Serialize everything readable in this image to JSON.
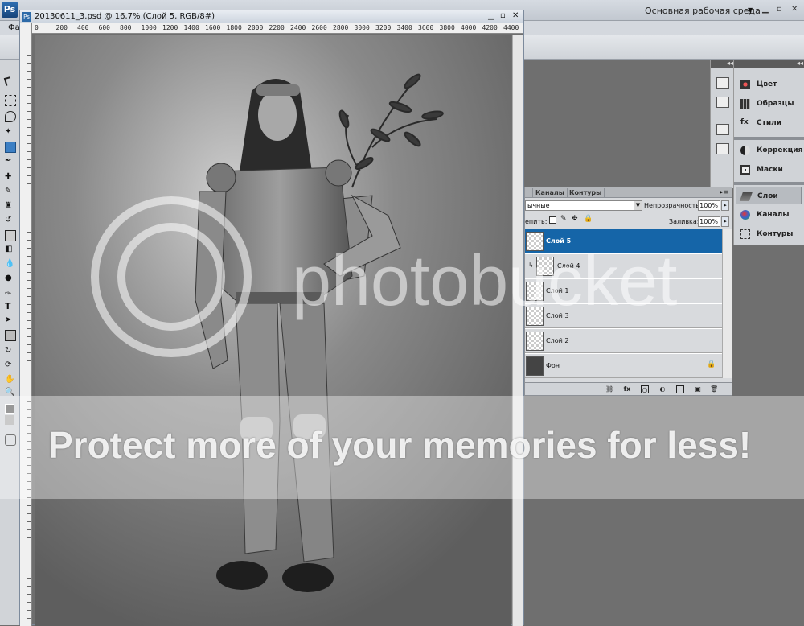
{
  "app": {
    "logo": "Ps",
    "menu_fragment": "Фа",
    "workspace": "Основная рабочая среда",
    "window_controls": [
      "▁",
      "▫",
      "✕"
    ]
  },
  "document": {
    "title": "20130611_3.psd @ 16,7% (Слой 5, RGB/8#)",
    "ruler_marks": [
      "0",
      "200",
      "400",
      "600",
      "800",
      "1000",
      "1200",
      "1400",
      "1600",
      "1800",
      "2000",
      "2200",
      "2400",
      "2600",
      "2800",
      "3000",
      "3200",
      "3400",
      "3600",
      "3800",
      "4000",
      "4200",
      "4400"
    ],
    "window_controls": [
      "▁",
      "▫",
      "✕"
    ]
  },
  "dock": {
    "collapse_label": "◂◂",
    "panels": [
      {
        "label": "Цвет",
        "icon": "color-palette-icon"
      },
      {
        "label": "Образцы",
        "icon": "swatches-icon"
      },
      {
        "label": "Стили",
        "icon": "styles-icon"
      },
      {
        "label": "Коррекция",
        "icon": "adjustments-icon"
      },
      {
        "label": "Маски",
        "icon": "masks-icon"
      },
      {
        "label": "Слои",
        "icon": "layers-icon",
        "active": true
      },
      {
        "label": "Каналы",
        "icon": "channels-icon"
      },
      {
        "label": "Контуры",
        "icon": "paths-icon"
      }
    ]
  },
  "layers_panel": {
    "tabs": [
      "",
      "Каналы",
      "Контуры"
    ],
    "menu_icon": "▸≡",
    "blend_mode": "ычные",
    "opacity_label": "Непрозрачность:",
    "opacity": "100%",
    "lock_label": "епить:",
    "fill_label": "Заливка:",
    "fill": "100%",
    "layers": [
      {
        "name": "Слой 5",
        "selected": true
      },
      {
        "name": "Слой 4",
        "clipped": true
      },
      {
        "name": "Слой 1"
      },
      {
        "name": "Слой 3"
      },
      {
        "name": "Слой 2"
      },
      {
        "name": "Фон",
        "locked": true
      }
    ]
  },
  "watermark": {
    "logo_text": "photobucket",
    "banner": "Protect more of your memories for less!"
  }
}
